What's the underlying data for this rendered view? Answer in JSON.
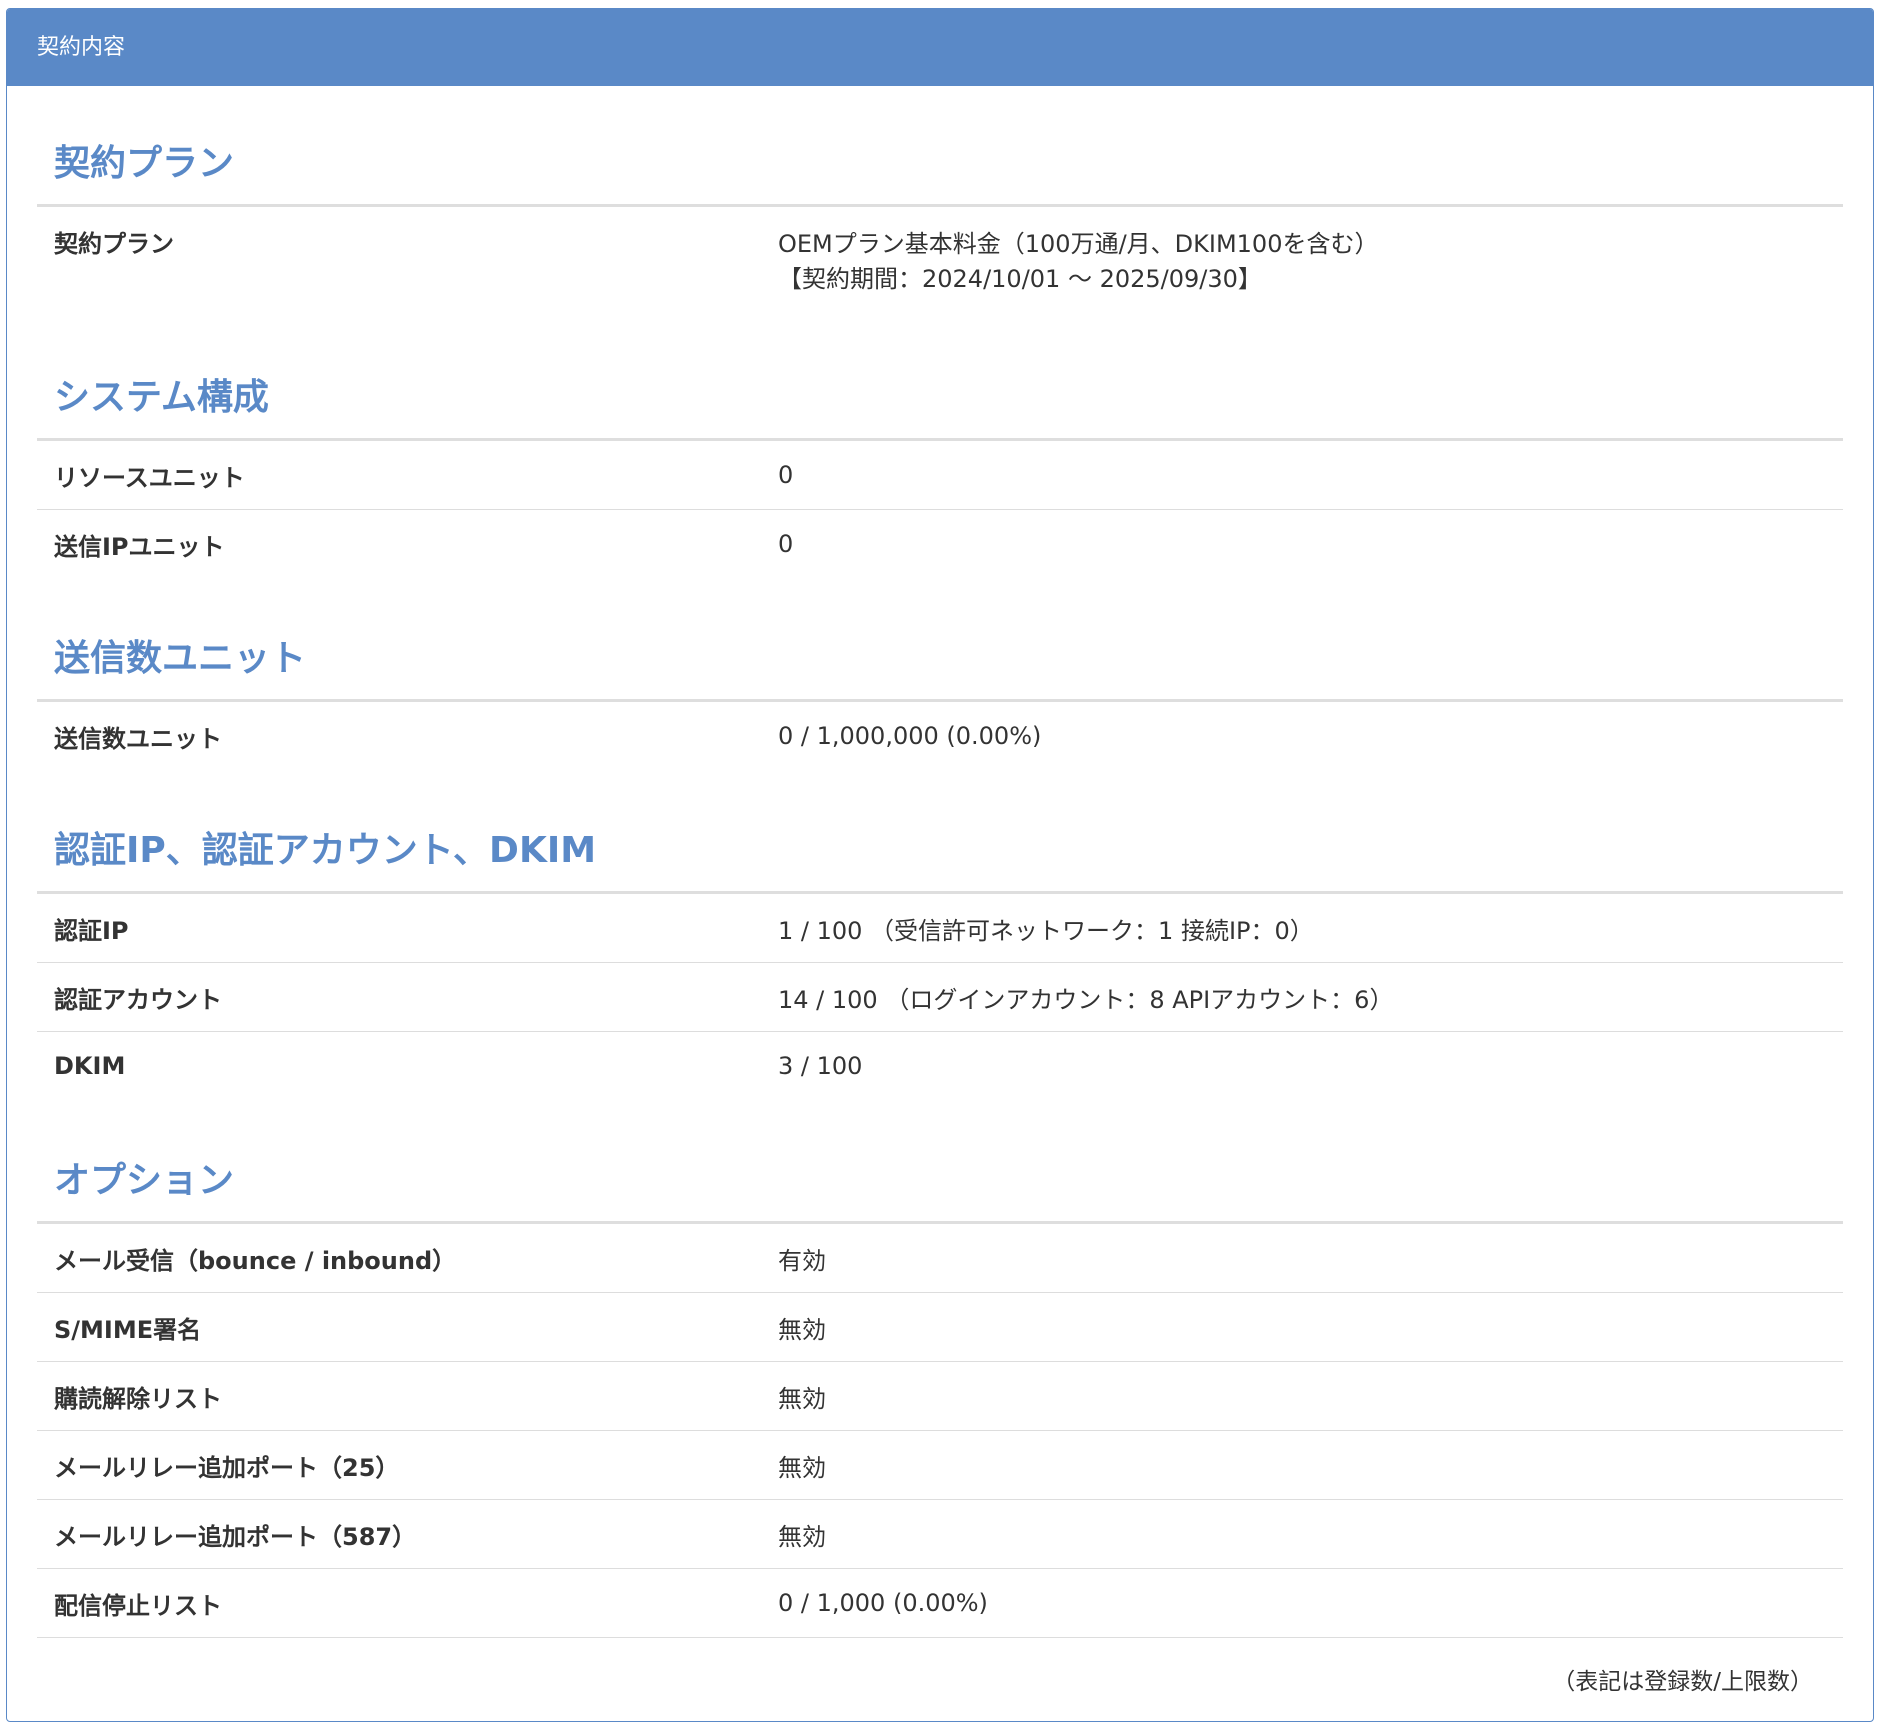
{
  "panel": {
    "title": "契約内容"
  },
  "sections": {
    "plan": {
      "title": "契約プラン",
      "rows": [
        {
          "label": "契約プラン",
          "value_line1": "OEMプラン基本料金（100万通/月、DKIM100を含む）",
          "value_line2": "【契約期間：2024/10/01 〜 2025/09/30】"
        }
      ]
    },
    "system": {
      "title": "システム構成",
      "rows": [
        {
          "label": "リソースユニット",
          "value": "0"
        },
        {
          "label": "送信IPユニット",
          "value": "0"
        }
      ]
    },
    "send_units": {
      "title": "送信数ユニット",
      "rows": [
        {
          "label": "送信数ユニット",
          "value": "0 / 1,000,000 (0.00%)"
        }
      ]
    },
    "auth": {
      "title": "認証IP、認証アカウント、DKIM",
      "rows": [
        {
          "label": "認証IP",
          "value": "1 / 100 （受信許可ネットワーク：1  接続IP：0）"
        },
        {
          "label": "認証アカウント",
          "value": "14 / 100 （ログインアカウント：8  APIアカウント：6）"
        },
        {
          "label": "DKIM",
          "value": "3 / 100"
        }
      ]
    },
    "options": {
      "title": "オプション",
      "rows": [
        {
          "label": "メール受信（bounce / inbound）",
          "value": "有効"
        },
        {
          "label": "S/MIME署名",
          "value": "無効"
        },
        {
          "label": "購読解除リスト",
          "value": "無効"
        },
        {
          "label": "メールリレー追加ポート（25）",
          "value": "無効"
        },
        {
          "label": "メールリレー追加ポート（587）",
          "value": "無効"
        },
        {
          "label": "配信停止リスト",
          "value": "0 / 1,000 (0.00%)"
        }
      ]
    }
  },
  "footnote": "（表記は登録数/上限数）"
}
